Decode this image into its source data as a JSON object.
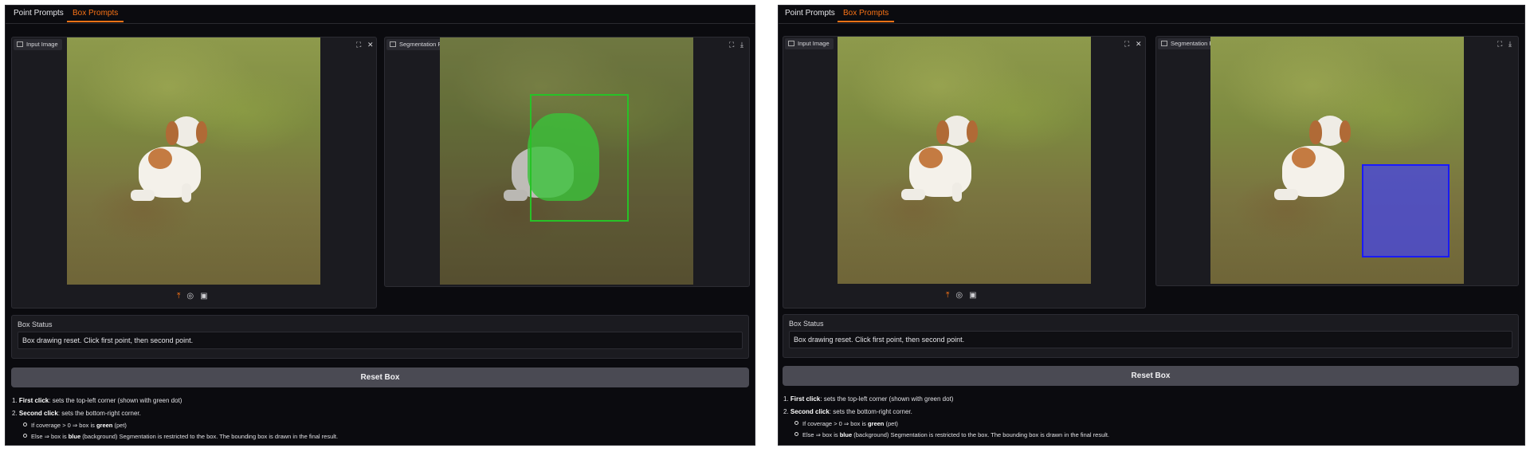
{
  "panels": [
    {
      "tabs": [
        "Point Prompts",
        "Box Prompts"
      ],
      "active_tab": "Box Prompts",
      "input_image": {
        "label": "Input Image",
        "buttons": [
          "fullscreen-icon",
          "close-icon"
        ],
        "toolbar": [
          "upload-icon",
          "webcam-icon",
          "clipboard-icon"
        ]
      },
      "result_image": {
        "label": "Segmentation Result",
        "buttons": [
          "fullscreen-icon",
          "download-icon"
        ],
        "box_color": "#22ff22",
        "box_kind": "green"
      },
      "status": {
        "title": "Box Status",
        "value": "Box drawing reset. Click first point, then second point."
      },
      "reset_button": "Reset Box",
      "instructions": {
        "step1_num": "1.",
        "step1_bold": "First click",
        "step1_rest": ": sets the top-left corner (shown with green dot)",
        "step2_num": "2.",
        "step2_bold": "Second click",
        "step2_rest": ": sets the bottom-right corner.",
        "bullet1_pre": "If coverage > 0 ⇒ box is ",
        "bullet1_bold": "green",
        "bullet1_post": " (pet)",
        "bullet2_pre": "Else ⇒ box is ",
        "bullet2_bold": "blue",
        "bullet2_post": " (background) Segmentation is restricted to the box. The bounding box is drawn in the final result."
      }
    },
    {
      "tabs": [
        "Point Prompts",
        "Box Prompts"
      ],
      "active_tab": "Box Prompts",
      "input_image": {
        "label": "Input Image",
        "buttons": [
          "fullscreen-icon",
          "close-icon"
        ],
        "toolbar": [
          "upload-icon",
          "webcam-icon",
          "clipboard-icon"
        ]
      },
      "result_image": {
        "label": "Segmentation Result",
        "buttons": [
          "fullscreen-icon",
          "download-icon"
        ],
        "box_color": "#1a1aff",
        "box_kind": "blue"
      },
      "status": {
        "title": "Box Status",
        "value": "Box drawing reset. Click first point, then second point."
      },
      "reset_button": "Reset Box",
      "instructions": {
        "step1_num": "1.",
        "step1_bold": "First click",
        "step1_rest": ": sets the top-left corner (shown with green dot)",
        "step2_num": "2.",
        "step2_bold": "Second click",
        "step2_rest": ": sets the bottom-right corner.",
        "bullet1_pre": "If coverage > 0 ⇒ box is ",
        "bullet1_bold": "green",
        "bullet1_post": " (pet)",
        "bullet2_pre": "Else ⇒ box is ",
        "bullet2_bold": "blue",
        "bullet2_post": " (background) Segmentation is restricted to the box. The bounding box is drawn in the final result."
      }
    }
  ],
  "accent_color": "#f97316"
}
